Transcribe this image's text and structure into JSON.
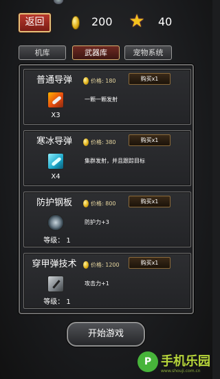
{
  "topbar": {
    "back_label": "返回",
    "coins": "200",
    "stars": "40"
  },
  "tabs": [
    {
      "label": "机库",
      "active": false
    },
    {
      "label": "武器库",
      "active": true
    },
    {
      "label": "宠物系统",
      "active": false
    }
  ],
  "items": [
    {
      "name": "普通导弹",
      "icon": "missile-icon",
      "count": "X3",
      "level": "",
      "price_label": "价格: 180",
      "buy_label": "购买x1",
      "desc": "一颗一颗发射"
    },
    {
      "name": "寒冰导弹",
      "icon": "ice-missile-icon",
      "count": "X4",
      "level": "",
      "price_label": "价格: 380",
      "buy_label": "购买x1",
      "desc": "集群发射，并且跟踪目标"
    },
    {
      "name": "防护钢板",
      "icon": "shield-plate-icon",
      "count": "",
      "level": "等级：  1",
      "price_label": "价格: 800",
      "buy_label": "购买x1",
      "desc": "防护力+3"
    },
    {
      "name": "穿甲弹技术",
      "icon": "armor-piercing-bullet-icon",
      "count": "",
      "level": "等级：  1",
      "price_label": "价格: 1200",
      "buy_label": "购买x1",
      "desc": "攻击力+1"
    }
  ],
  "start_label": "开始游戏",
  "watermark": {
    "badge": "P",
    "text": "手机乐园",
    "sub": "www.shouji.com.cn"
  },
  "colors": {
    "accent_red": "#b8382c",
    "gold": "#e0b018",
    "watermark_green": "#47b43a"
  }
}
